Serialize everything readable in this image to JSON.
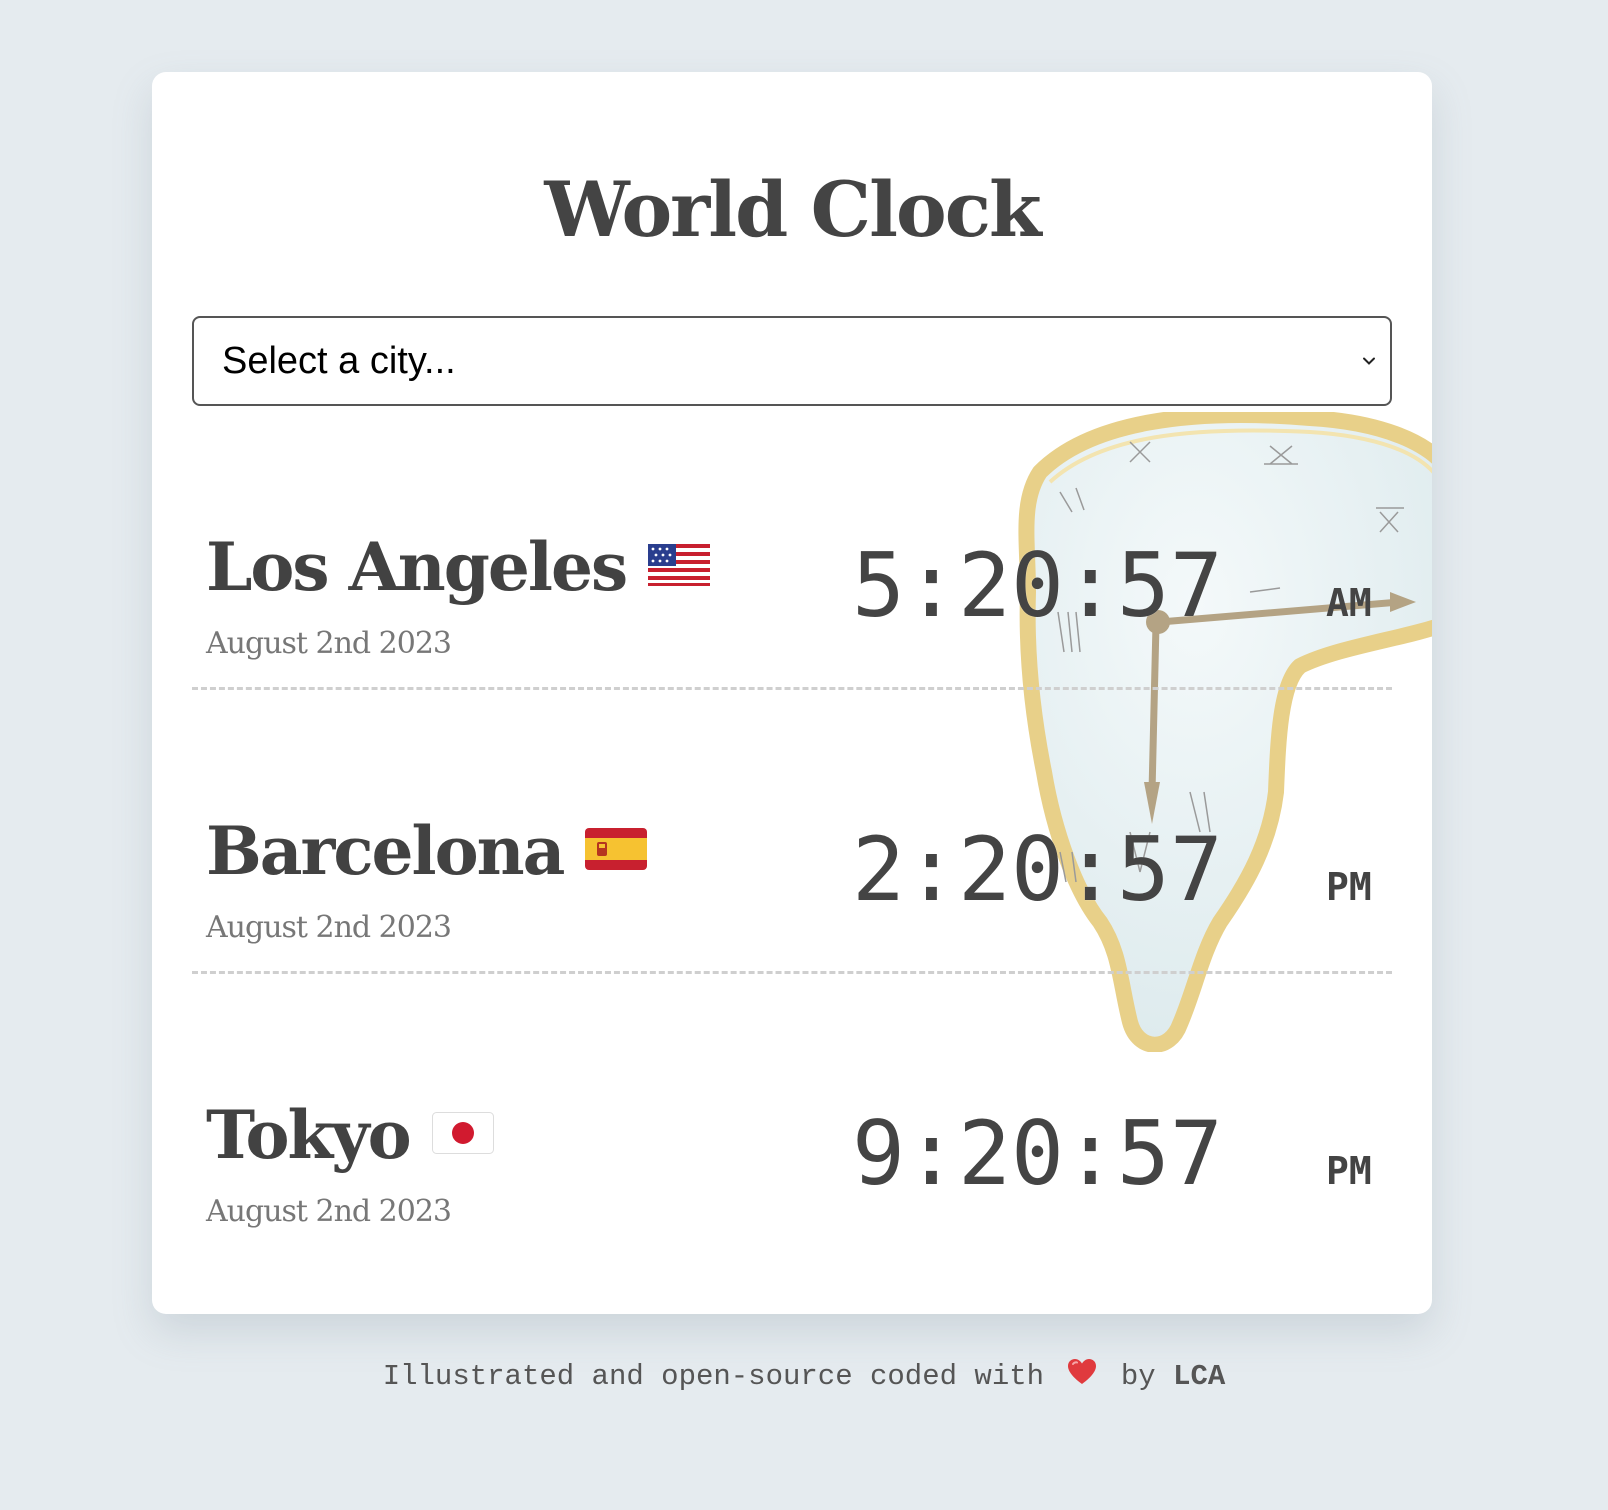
{
  "app": {
    "title": "World Clock"
  },
  "city_select": {
    "placeholder": "Select a city..."
  },
  "clocks": [
    {
      "city": "Los Angeles",
      "flag": "us-flag-icon",
      "date": "August 2nd 2023",
      "time": "5:20:57",
      "period": "AM"
    },
    {
      "city": "Barcelona",
      "flag": "spain-flag-icon",
      "date": "August 2nd 2023",
      "time": "2:20:57",
      "period": "PM"
    },
    {
      "city": "Tokyo",
      "flag": "japan-flag-icon",
      "date": "August 2nd 2023",
      "time": "9:20:57",
      "period": "PM"
    }
  ],
  "footer": {
    "text_before": "Illustrated and open-source coded with",
    "heart_icon": "heart-icon",
    "by": "by",
    "author": "LCA"
  },
  "colors": {
    "background": "#e5ebef",
    "card": "#ffffff",
    "text": "#424242",
    "date_text": "#777777",
    "melting_clock_frame": "#e8d089"
  }
}
